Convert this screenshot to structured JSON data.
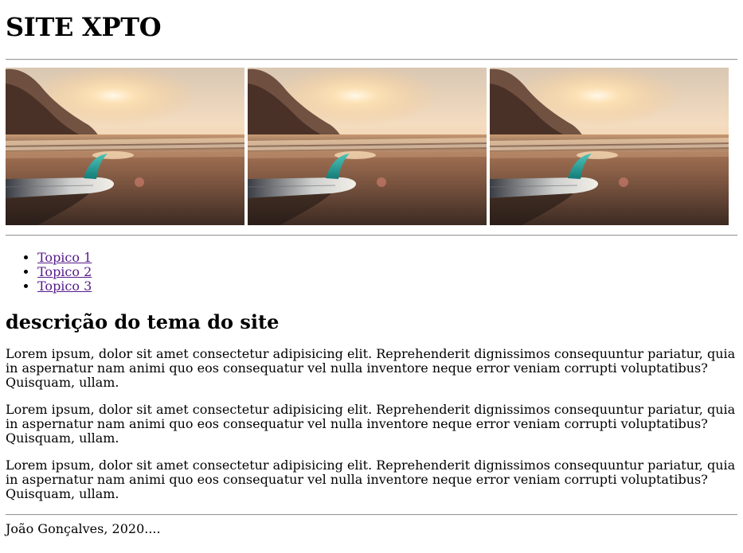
{
  "site_title": "SITE XPTO",
  "gallery": {
    "images": [
      {
        "name": "beach-surfboard-sunset-photo-1"
      },
      {
        "name": "beach-surfboard-sunset-photo-2"
      },
      {
        "name": "beach-surfboard-sunset-photo-3"
      }
    ]
  },
  "nav": {
    "topics": [
      "Topico 1",
      "Topico 2",
      "Topico 3"
    ]
  },
  "main": {
    "heading": "descrição do tema do site",
    "paragraphs": [
      "Lorem ipsum, dolor sit amet consectetur adipisicing elit. Reprehenderit dignissimos consequuntur pariatur, quia in aspernatur nam animi quo eos consequatur vel nulla inventore neque error veniam corrupti voluptatibus? Quisquam, ullam.",
      "Lorem ipsum, dolor sit amet consectetur adipisicing elit. Reprehenderit dignissimos consequuntur pariatur, quia in aspernatur nam animi quo eos consequatur vel nulla inventore neque error veniam corrupti voluptatibus? Quisquam, ullam.",
      "Lorem ipsum, dolor sit amet consectetur adipisicing elit. Reprehenderit dignissimos consequuntur pariatur, quia in aspernatur nam animi quo eos consequatur vel nulla inventore neque error veniam corrupti voluptatibus? Quisquam, ullam."
    ]
  },
  "footer": {
    "text": "João Gonçalves, 2020...."
  },
  "colors": {
    "link_visited": "#551a8b",
    "hr": "#9a9a9a"
  }
}
